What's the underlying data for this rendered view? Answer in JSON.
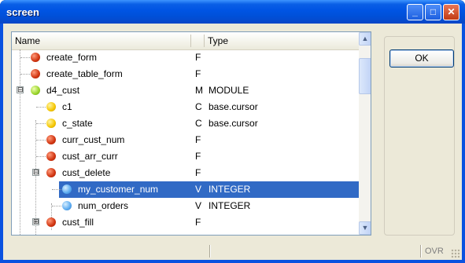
{
  "window": {
    "title": "screen"
  },
  "title_buttons": {
    "minimize": "_",
    "maximize": "□",
    "close": "✕"
  },
  "tree": {
    "columns": {
      "name": "Name",
      "type": "Type"
    },
    "rows": [
      {
        "name": "create_form",
        "kind": "F",
        "type": "",
        "icon": "red-dot"
      },
      {
        "name": "create_table_form",
        "kind": "F",
        "type": "",
        "icon": "red-dot"
      },
      {
        "name": "d4_cust",
        "kind": "M",
        "type": "MODULE",
        "icon": "green-dot",
        "expander": "⊟"
      },
      {
        "name": "c1",
        "kind": "C",
        "type": "base.cursor",
        "icon": "yellow-dot"
      },
      {
        "name": "c_state",
        "kind": "C",
        "type": "base.cursor",
        "icon": "yellow-dot"
      },
      {
        "name": "curr_cust_num",
        "kind": "F",
        "type": "",
        "icon": "red-dot"
      },
      {
        "name": "cust_arr_curr",
        "kind": "F",
        "type": "",
        "icon": "red-dot"
      },
      {
        "name": "cust_delete",
        "kind": "F",
        "type": "",
        "icon": "red-dot",
        "expander": "⊟"
      },
      {
        "name": "my_customer_num",
        "kind": "V",
        "type": "INTEGER",
        "icon": "blue-dot",
        "selected": true
      },
      {
        "name": "num_orders",
        "kind": "V",
        "type": "INTEGER",
        "icon": "blue-dot"
      },
      {
        "name": "cust_fill",
        "kind": "F",
        "type": "",
        "icon": "red-dot",
        "expander": "⊞"
      }
    ]
  },
  "ok_button": {
    "label": "OK"
  },
  "status_bar": {
    "mode": "OVR"
  },
  "colors": {
    "selection": "#316ac5",
    "title_bar": "#0054e3",
    "dialog_bg": "#ece9d8"
  }
}
